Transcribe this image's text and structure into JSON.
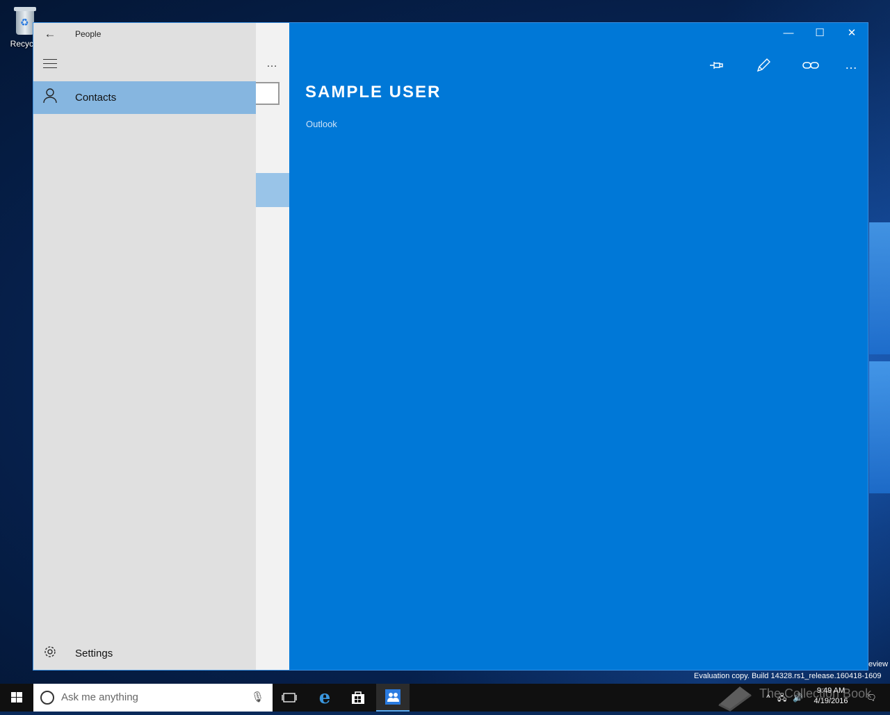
{
  "desktop": {
    "recycle_bin_label": "Recycle"
  },
  "app": {
    "title": "People",
    "nav_items": [
      {
        "label": "Contacts",
        "icon": "person-icon",
        "active": true
      },
      {
        "label": "Settings",
        "icon": "gear-icon",
        "active": false
      }
    ],
    "list_more": "…"
  },
  "contact": {
    "name": "SAMPLE USER",
    "source": "Outlook"
  },
  "window_controls": {
    "minimize": "—",
    "maximize": "☐",
    "close": "✕"
  },
  "commands": {
    "more": "…"
  },
  "taskbar": {
    "search_placeholder": "Ask me anything",
    "clock_time": "9:49 AM",
    "clock_date": "4/19/2016"
  },
  "system": {
    "evaluation_text": "Evaluation copy. Build 14328.rs1_release.160418-1609",
    "edge_text": "eview"
  },
  "watermark_text": "The Collection Book",
  "colors": {
    "accent": "#0078d7",
    "nav_selected": "#86b6e0",
    "taskbar": "#101010"
  }
}
